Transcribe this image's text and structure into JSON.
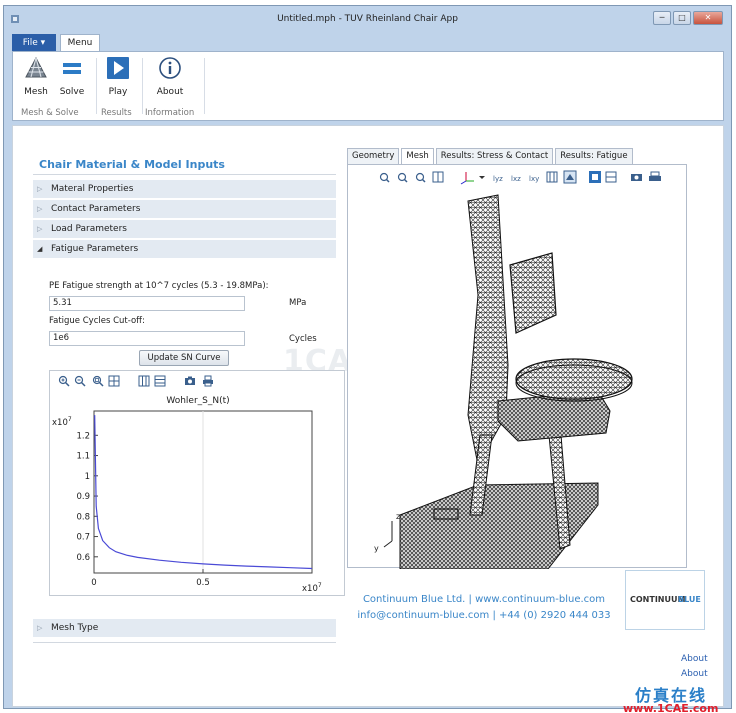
{
  "window": {
    "title": "Untitled.mph - TUV Rheinland Chair App"
  },
  "ribbon": {
    "file_tab": "File ▾",
    "menu_tab": "Menu",
    "buttons": {
      "mesh": "Mesh",
      "solve": "Solve",
      "play": "Play",
      "about": "About"
    },
    "groups": {
      "mesh_solve": "Mesh & Solve",
      "results": "Results",
      "information": "Information"
    }
  },
  "left_panel": {
    "title": "Chair Material & Model Inputs",
    "sections": {
      "material": "Materal Properties",
      "contact": "Contact Parameters",
      "load": "Load Parameters",
      "fatigue": "Fatigue Parameters",
      "mesh_type": "Mesh Type"
    },
    "fatigue": {
      "strength_label": "PE Fatigue strength at 10^7 cycles (5.3 - 19.8MPa):",
      "strength_value": "5.31",
      "strength_unit": "MPa",
      "cutoff_label": "Fatigue Cycles Cut-off:",
      "cutoff_value": "1e6",
      "cutoff_unit": "Cycles",
      "update_button": "Update SN Curve"
    }
  },
  "plot": {
    "title": "Wohler_S_N(t)",
    "y_exponent": "x10",
    "y_exponent_power": "7",
    "x_exponent": "x10",
    "x_exponent_power": "7",
    "y_ticks": [
      "1.2",
      "1.1",
      "1",
      "0.9",
      "0.8",
      "0.7",
      "0.6"
    ],
    "x_ticks": [
      "0",
      "0.5"
    ]
  },
  "chart_data": {
    "type": "line",
    "title": "Wohler_S_N(t)",
    "xlabel": "",
    "ylabel": "",
    "xlim": [
      0,
      1
    ],
    "ylim": [
      0.52,
      1.32
    ],
    "x_scale_exponent": 7,
    "y_scale_exponent": 7,
    "grid": true,
    "series": [
      {
        "x": [
          0.003,
          0.01,
          0.02,
          0.04,
          0.07,
          0.1,
          0.15,
          0.2,
          0.3,
          0.4,
          0.5,
          0.6,
          0.7,
          0.8,
          0.9,
          1.0
        ],
        "y": [
          1.3,
          0.85,
          0.74,
          0.68,
          0.645,
          0.625,
          0.608,
          0.597,
          0.583,
          0.573,
          0.565,
          0.559,
          0.554,
          0.55,
          0.546,
          0.542
        ],
        "color": "#4a4ad6"
      }
    ]
  },
  "right_panel": {
    "tabs": [
      "Geometry",
      "Mesh",
      "Results: Stress & Contact",
      "Results: Fatigue"
    ],
    "active_tab": "Mesh",
    "axis_labels": {
      "z": "z",
      "y": "y"
    }
  },
  "footer": {
    "company_line1": "Continuum Blue Ltd. | www.continuum-blue.com",
    "company_line2": "info@continuum-blue.com | +44 (0) 2920 444 033",
    "logo_text_a": "CONTINUUM",
    "logo_text_b": "BLUE",
    "about_1": "About",
    "about_2": "About"
  },
  "watermarks": {
    "center": "1CAE.COM",
    "cn": "仿真在线",
    "url": "www.1CAE.com"
  },
  "colors": {
    "accent": "#3a86c8",
    "file_tab": "#2b5ea8",
    "section_bg": "#e3eaf2"
  }
}
